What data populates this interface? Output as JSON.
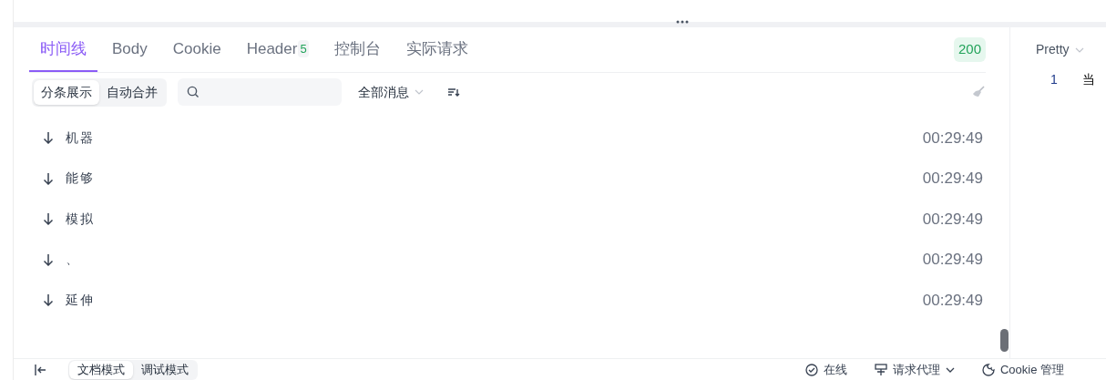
{
  "tabs": [
    {
      "label": "时间线",
      "selected": true
    },
    {
      "label": "Body",
      "selected": false
    },
    {
      "label": "Cookie",
      "selected": false
    },
    {
      "label": "Header",
      "badge": "5",
      "selected": false
    },
    {
      "label": "控制台",
      "selected": false
    },
    {
      "label": "实际请求",
      "selected": false
    }
  ],
  "status_code": "200",
  "view_modes": [
    {
      "label": "分条展示",
      "selected": true
    },
    {
      "label": "自动合并",
      "selected": false
    }
  ],
  "filter": {
    "label": "全部消息"
  },
  "messages": [
    {
      "text": "机器",
      "time": "00:29:49"
    },
    {
      "text": "能够",
      "time": "00:29:49"
    },
    {
      "text": "模拟",
      "time": "00:29:49"
    },
    {
      "text": "、",
      "time": "00:29:49"
    },
    {
      "text": "延伸",
      "time": "00:29:49"
    }
  ],
  "preview": {
    "format": "Pretty",
    "lines": [
      {
        "number": "1",
        "text": "当"
      }
    ]
  },
  "footer": {
    "modes": [
      {
        "label": "文档模式",
        "selected": true
      },
      {
        "label": "调试模式",
        "selected": false
      }
    ],
    "actions": [
      {
        "kind": "online",
        "label": "在线"
      },
      {
        "kind": "proxy",
        "label": "请求代理"
      },
      {
        "kind": "cookie",
        "label": "Cookie 管理"
      }
    ]
  }
}
